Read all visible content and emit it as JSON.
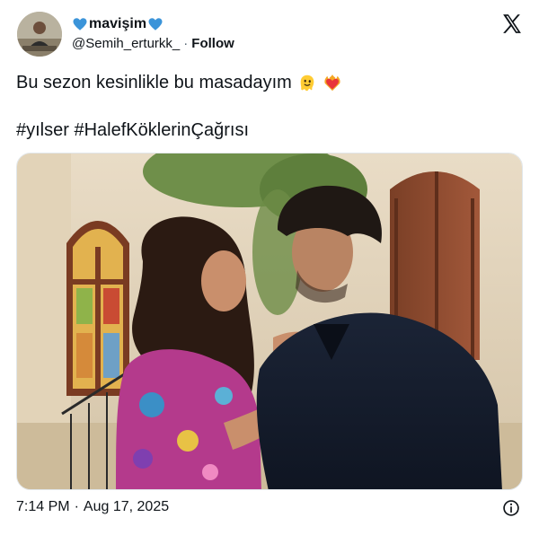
{
  "user": {
    "display_name": "mavişim",
    "handle": "@Semih_erturkk_",
    "separator": "·",
    "follow_label": "Follow"
  },
  "icons": {
    "left_heart": "blue-heart-icon",
    "right_heart": "blue-heart-icon",
    "brand": "x-logo-icon",
    "info": "info-icon",
    "emoji_1": "melting-face-emoji",
    "emoji_2": "heart-on-fire-emoji"
  },
  "tweet": {
    "line1": "Bu sezon kesinlikle bu masadayım",
    "hashtag1": "#yılser",
    "hashtag2": "#HalefKöklerinÇağrısı",
    "image_alt": "Photo of a woman in a floral dress and a man in a dark suit in front of a stone building"
  },
  "meta": {
    "time": "7:14 PM",
    "separator": "·",
    "date": "Aug 17, 2025"
  },
  "colors": {
    "heart_blue": "#3b94d9",
    "text": "#0f1419",
    "secondary": "#536471"
  }
}
